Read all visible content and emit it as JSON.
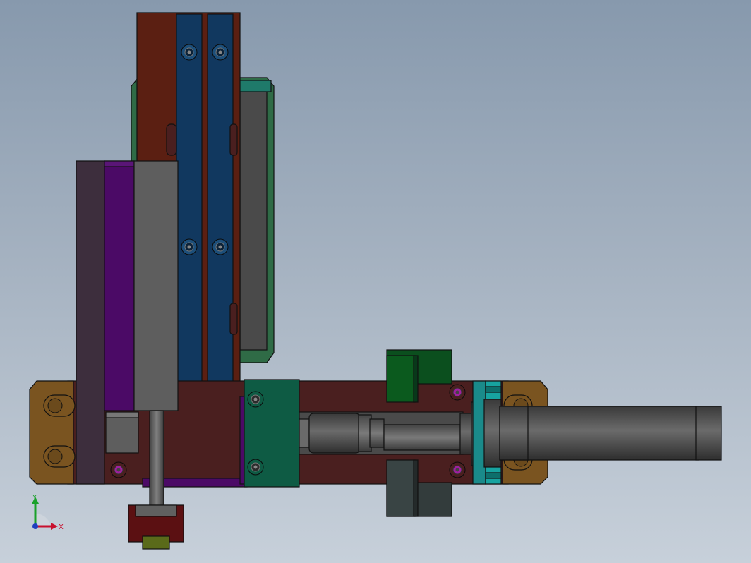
{
  "axes": {
    "x_label": "X",
    "y_label": "Y",
    "x_color": "#c8102e",
    "y_color": "#1aa12a",
    "z_color": "#1f3fbf"
  },
  "colors": {
    "background_top": "#8799ad",
    "background_bottom": "#c7d0da",
    "rail_red": "#5b1f12",
    "slide_blue": "#11385f",
    "guide_green": "#2f6b46",
    "guide_inner": "#4a4a4a",
    "purple_plate": "#4b0a66",
    "dark_plate": "#3d2e3d",
    "gray_block": "#5e5e5e",
    "base_plate": "#4a1f1f",
    "bracket_brown": "#7a5420",
    "teal_block": "#0e5b44",
    "green_block": "#0b4f1e",
    "cyan_ring": "#1a8a8a",
    "cylinder_gray": "#555555",
    "bolt_magenta": "#a020a0"
  },
  "icons": [
    "axis-triad-icon"
  ]
}
